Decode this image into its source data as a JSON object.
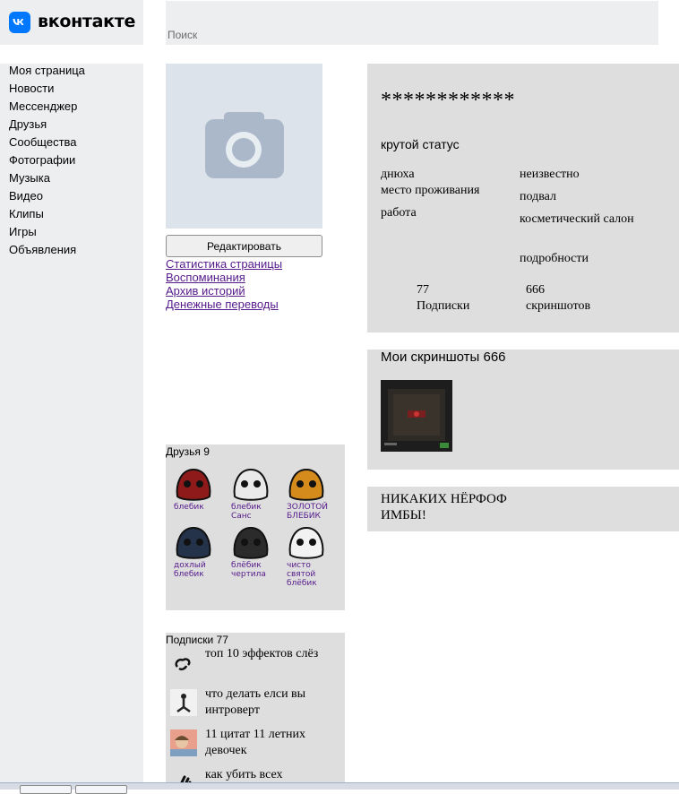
{
  "header": {
    "logo_icon": "vk-logo-icon",
    "logo_text": "вконтакте",
    "search_placeholder": "Поиск"
  },
  "sidebar": {
    "items": [
      {
        "label": "Моя страница"
      },
      {
        "label": "Новости"
      },
      {
        "label": "Мессенджер"
      },
      {
        "label": "Друзья"
      },
      {
        "label": "Сообщества"
      },
      {
        "label": "Фотографии"
      },
      {
        "label": "Музыка"
      },
      {
        "label": "Видео"
      },
      {
        "label": "Клипы"
      },
      {
        "label": "Игры"
      },
      {
        "label": "Объявления"
      }
    ]
  },
  "profile": {
    "avatar_icon": "camera-icon",
    "edit_label": "Редактировать",
    "links": [
      {
        "label": "Статистика страницы"
      },
      {
        "label": "Воспоминания"
      },
      {
        "label": "Архив историй"
      },
      {
        "label": "Денежные переводы"
      }
    ]
  },
  "info": {
    "name": "************",
    "status": "крутой статус",
    "birthday_label": "днюха",
    "birthday_value": "неизвестно",
    "residence_label": "место проживания",
    "residence_value": "подвал",
    "work_label": "работа",
    "work_value": "косметический салон",
    "details_label": "подробности",
    "subscriptions_count": "77",
    "subscriptions_label": "Подписки",
    "screenshots_count": "666",
    "screenshots_label": "скриншотов"
  },
  "friends": {
    "title": "Друзья 9",
    "items": [
      {
        "name": "блебик",
        "color": "#8e1a1a"
      },
      {
        "name": "блебик Санс",
        "color": "#e9e9e9"
      },
      {
        "name": "ЗОЛОТОЙ БЛЕБИК",
        "color": "#d58b1c"
      },
      {
        "name": "дохлый блебик",
        "color": "#24324a"
      },
      {
        "name": "блёбик чертила",
        "color": "#2b2b2b"
      },
      {
        "name": "чисто святой блёбик",
        "color": "#f2f2f2"
      }
    ]
  },
  "subscriptions": {
    "title": "Подписки 77",
    "items": [
      {
        "title": "топ 10 эффектов слёз",
        "icon": "link-icon"
      },
      {
        "title": "что делать елси вы интроверт",
        "icon": "person-thumb"
      },
      {
        "title": "11 цитат 11 летних девочек",
        "icon": "photo-thumb"
      },
      {
        "title": "как убить всех",
        "icon": "hands-icon"
      }
    ]
  },
  "screenshots": {
    "title": "Мои скриншоты 666"
  },
  "post": {
    "text": "НИКАКИХ НЁРФОФ ИМБЫ!"
  }
}
